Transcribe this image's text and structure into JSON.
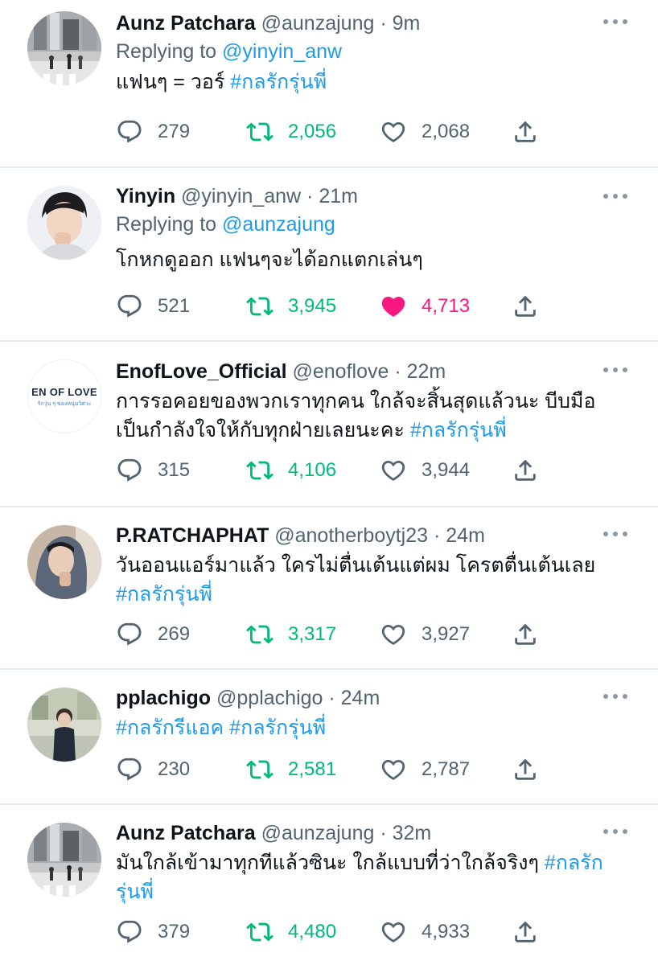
{
  "colors": {
    "link": "#1d9bf0",
    "retweet": "#00ba7c",
    "like_active": "#f91880",
    "muted": "#536471"
  },
  "reply_prefix": "Replying to",
  "tweets": [
    {
      "name": "Aunz Patchara",
      "handle": "@aunzajung",
      "time": "9m",
      "reply_to": "@yinyin_anw",
      "text": "แฟนๆ = วอร์ ",
      "hashtag": "#กลรักรุ่นพี่",
      "replies": "279",
      "retweets": "2,056",
      "likes": "2,068",
      "liked": false,
      "avatar_icon": "city-street-photo"
    },
    {
      "name": "Yinyin",
      "handle": "@yinyin_anw",
      "time": "21m",
      "reply_to": "@aunzajung",
      "text": "โกหกดูออก แฟนๆจะได้อกแตกเล่นๆ",
      "hashtag": "",
      "replies": "521",
      "retweets": "3,945",
      "likes": "4,713",
      "liked": true,
      "avatar_icon": "portrait-photo"
    },
    {
      "name": "EnofLove_Official",
      "handle": "@enoflove",
      "time": "22m",
      "line1": "การรอคอยของพวกเราทุกคน ใกล้จะสิ้นสุดแล้วนะ บีบมือ",
      "line2": "เป็นกำลังใจให้กับทุกฝ่ายเลยนะคะ ",
      "hashtag": "#กลรักรุ่นพี่",
      "replies": "315",
      "retweets": "4,106",
      "likes": "3,944",
      "liked": false,
      "logo_text": "EN OF LOVE",
      "logo_subtext": "รักวุ่น ๆ ของหนุ่มวิศวะ"
    },
    {
      "name": "P.RATCHAPHAT",
      "handle": "@anotherboytj23",
      "time": "24m",
      "line1": "วันออนแอร์มาแล้ว ใครไม่ตื่นเต้นแต่ผม โครตตื่นเต้นเลย",
      "hashtag": "#กลรักรุ่นพี่",
      "replies": "269",
      "retweets": "3,317",
      "likes": "3,927",
      "liked": false,
      "avatar_icon": "hooded-portrait-photo"
    },
    {
      "name": "pplachigo",
      "handle": "@pplachigo",
      "time": "24m",
      "hashtag1": "#กลรักรีแอค",
      "hashtag2": "#กลรักรุ่นพี่",
      "replies": "230",
      "retweets": "2,581",
      "likes": "2,787",
      "liked": false,
      "avatar_icon": "outdoor-portrait-photo"
    },
    {
      "name": "Aunz Patchara",
      "handle": "@aunzajung",
      "time": "32m",
      "line1": "มันใกล้เข้ามาทุกทีแล้วซินะ ใกล้แบบที่ว่าใกล้จริงๆ ",
      "hashtag_a": "#กลรัก",
      "hashtag_b": "รุ่นพี่",
      "replies": "379",
      "retweets": "4,480",
      "likes": "4,933",
      "liked": false,
      "avatar_icon": "city-street-photo"
    }
  ]
}
